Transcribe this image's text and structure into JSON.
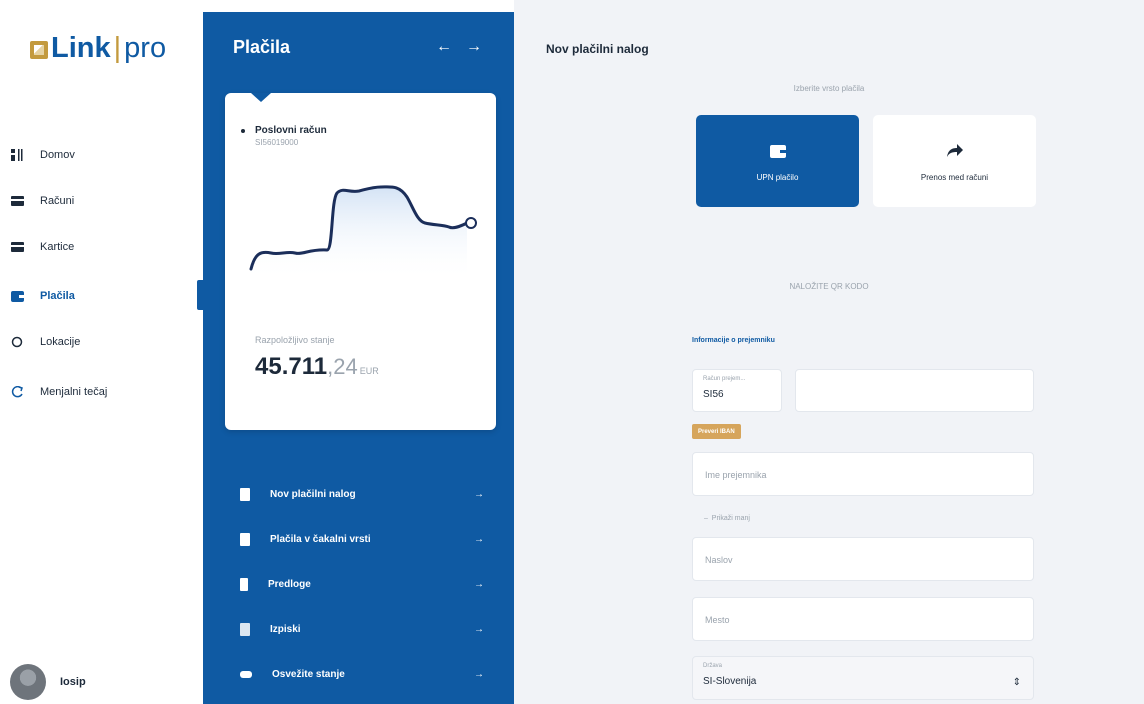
{
  "brand": {
    "link": "Link",
    "pro": "pro"
  },
  "nav": {
    "items": [
      {
        "label": "Domov",
        "icon": "home-icon"
      },
      {
        "label": "Računi",
        "icon": "accounts-icon"
      },
      {
        "label": "Kartice",
        "icon": "cards-icon"
      },
      {
        "label": "Plačila",
        "icon": "wallet-icon"
      },
      {
        "label": "Lokacije",
        "icon": "location-icon"
      },
      {
        "label": "Menjalni tečaj",
        "icon": "exchange-icon"
      }
    ],
    "active_index": 3,
    "user_name": "Iosip"
  },
  "panel": {
    "title": "Plačila",
    "account_name": "Poslovni račun",
    "account_number": "SI56019000",
    "balance_label": "Razpoložljivo stanje",
    "balance_main": "45.711",
    "balance_decimals": ",24",
    "balance_currency": "EUR",
    "menu": [
      {
        "label": "Nov plačilni nalog",
        "icon": "document-icon"
      },
      {
        "label": "Plačila v čakalni vrsti",
        "icon": "document-icon"
      },
      {
        "label": "Predloge",
        "icon": "template-icon"
      },
      {
        "label": "Izpiski",
        "icon": "statement-icon"
      },
      {
        "label": "Osvežite stanje",
        "icon": "refresh-icon"
      }
    ]
  },
  "form": {
    "title": "Nov plačilni nalog",
    "choose_type_hint": "Izberite vrsto plačila",
    "types": [
      {
        "label": "UPN plačilo",
        "icon": "wallet-icon"
      },
      {
        "label": "Prenos med računi",
        "icon": "share-arrow-icon"
      }
    ],
    "scan_qr_hint": "NALOŽITE QR KODO",
    "info_section": "Informacije o prejemniku",
    "account_label": "Račun prejem...",
    "account_prefix": "SI56",
    "badge": "Preveri IBAN",
    "recipient_placeholder": "Ime prejemnika",
    "more_label": "Prikaži manj",
    "address_placeholder": "Naslov",
    "city_placeholder": "Mesto",
    "country_label": "Država",
    "country_value": "SI-Slovenija"
  },
  "colors": {
    "brand_blue": "#0f5aa3",
    "gold": "#c39a3e",
    "badge": "#d6a55c",
    "background": "#f1f3f7"
  }
}
